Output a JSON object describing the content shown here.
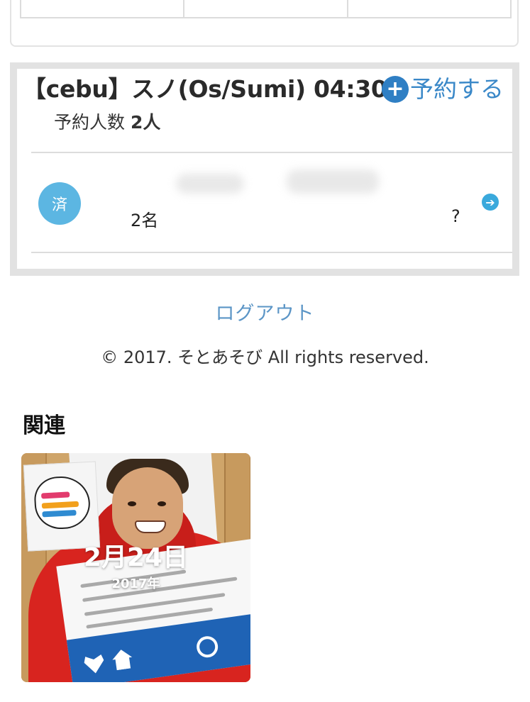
{
  "reservation": {
    "title": "【cebu】スノ(Os/Sumi) 04:30",
    "reserve_label": "予約する",
    "count_label": "予約人数",
    "count_value": "2人",
    "entry": {
      "status_badge": "済",
      "people": "2名",
      "note": "?"
    }
  },
  "footer": {
    "logout_label": "ログアウト",
    "copyright": "© 2017. そとあそび All rights reserved."
  },
  "related": {
    "heading": "関連",
    "items": [
      {
        "date": "2月24日",
        "year": "2017年"
      }
    ]
  },
  "colors": {
    "link": "#3a88c8",
    "plus_icon": "#2f7fc4",
    "badge": "#5cb6e2",
    "panel_border": "#e2e2e2"
  },
  "icons": {
    "reserve": "plus-circle-icon",
    "entry_detail": "arrow-right-circle-icon"
  }
}
